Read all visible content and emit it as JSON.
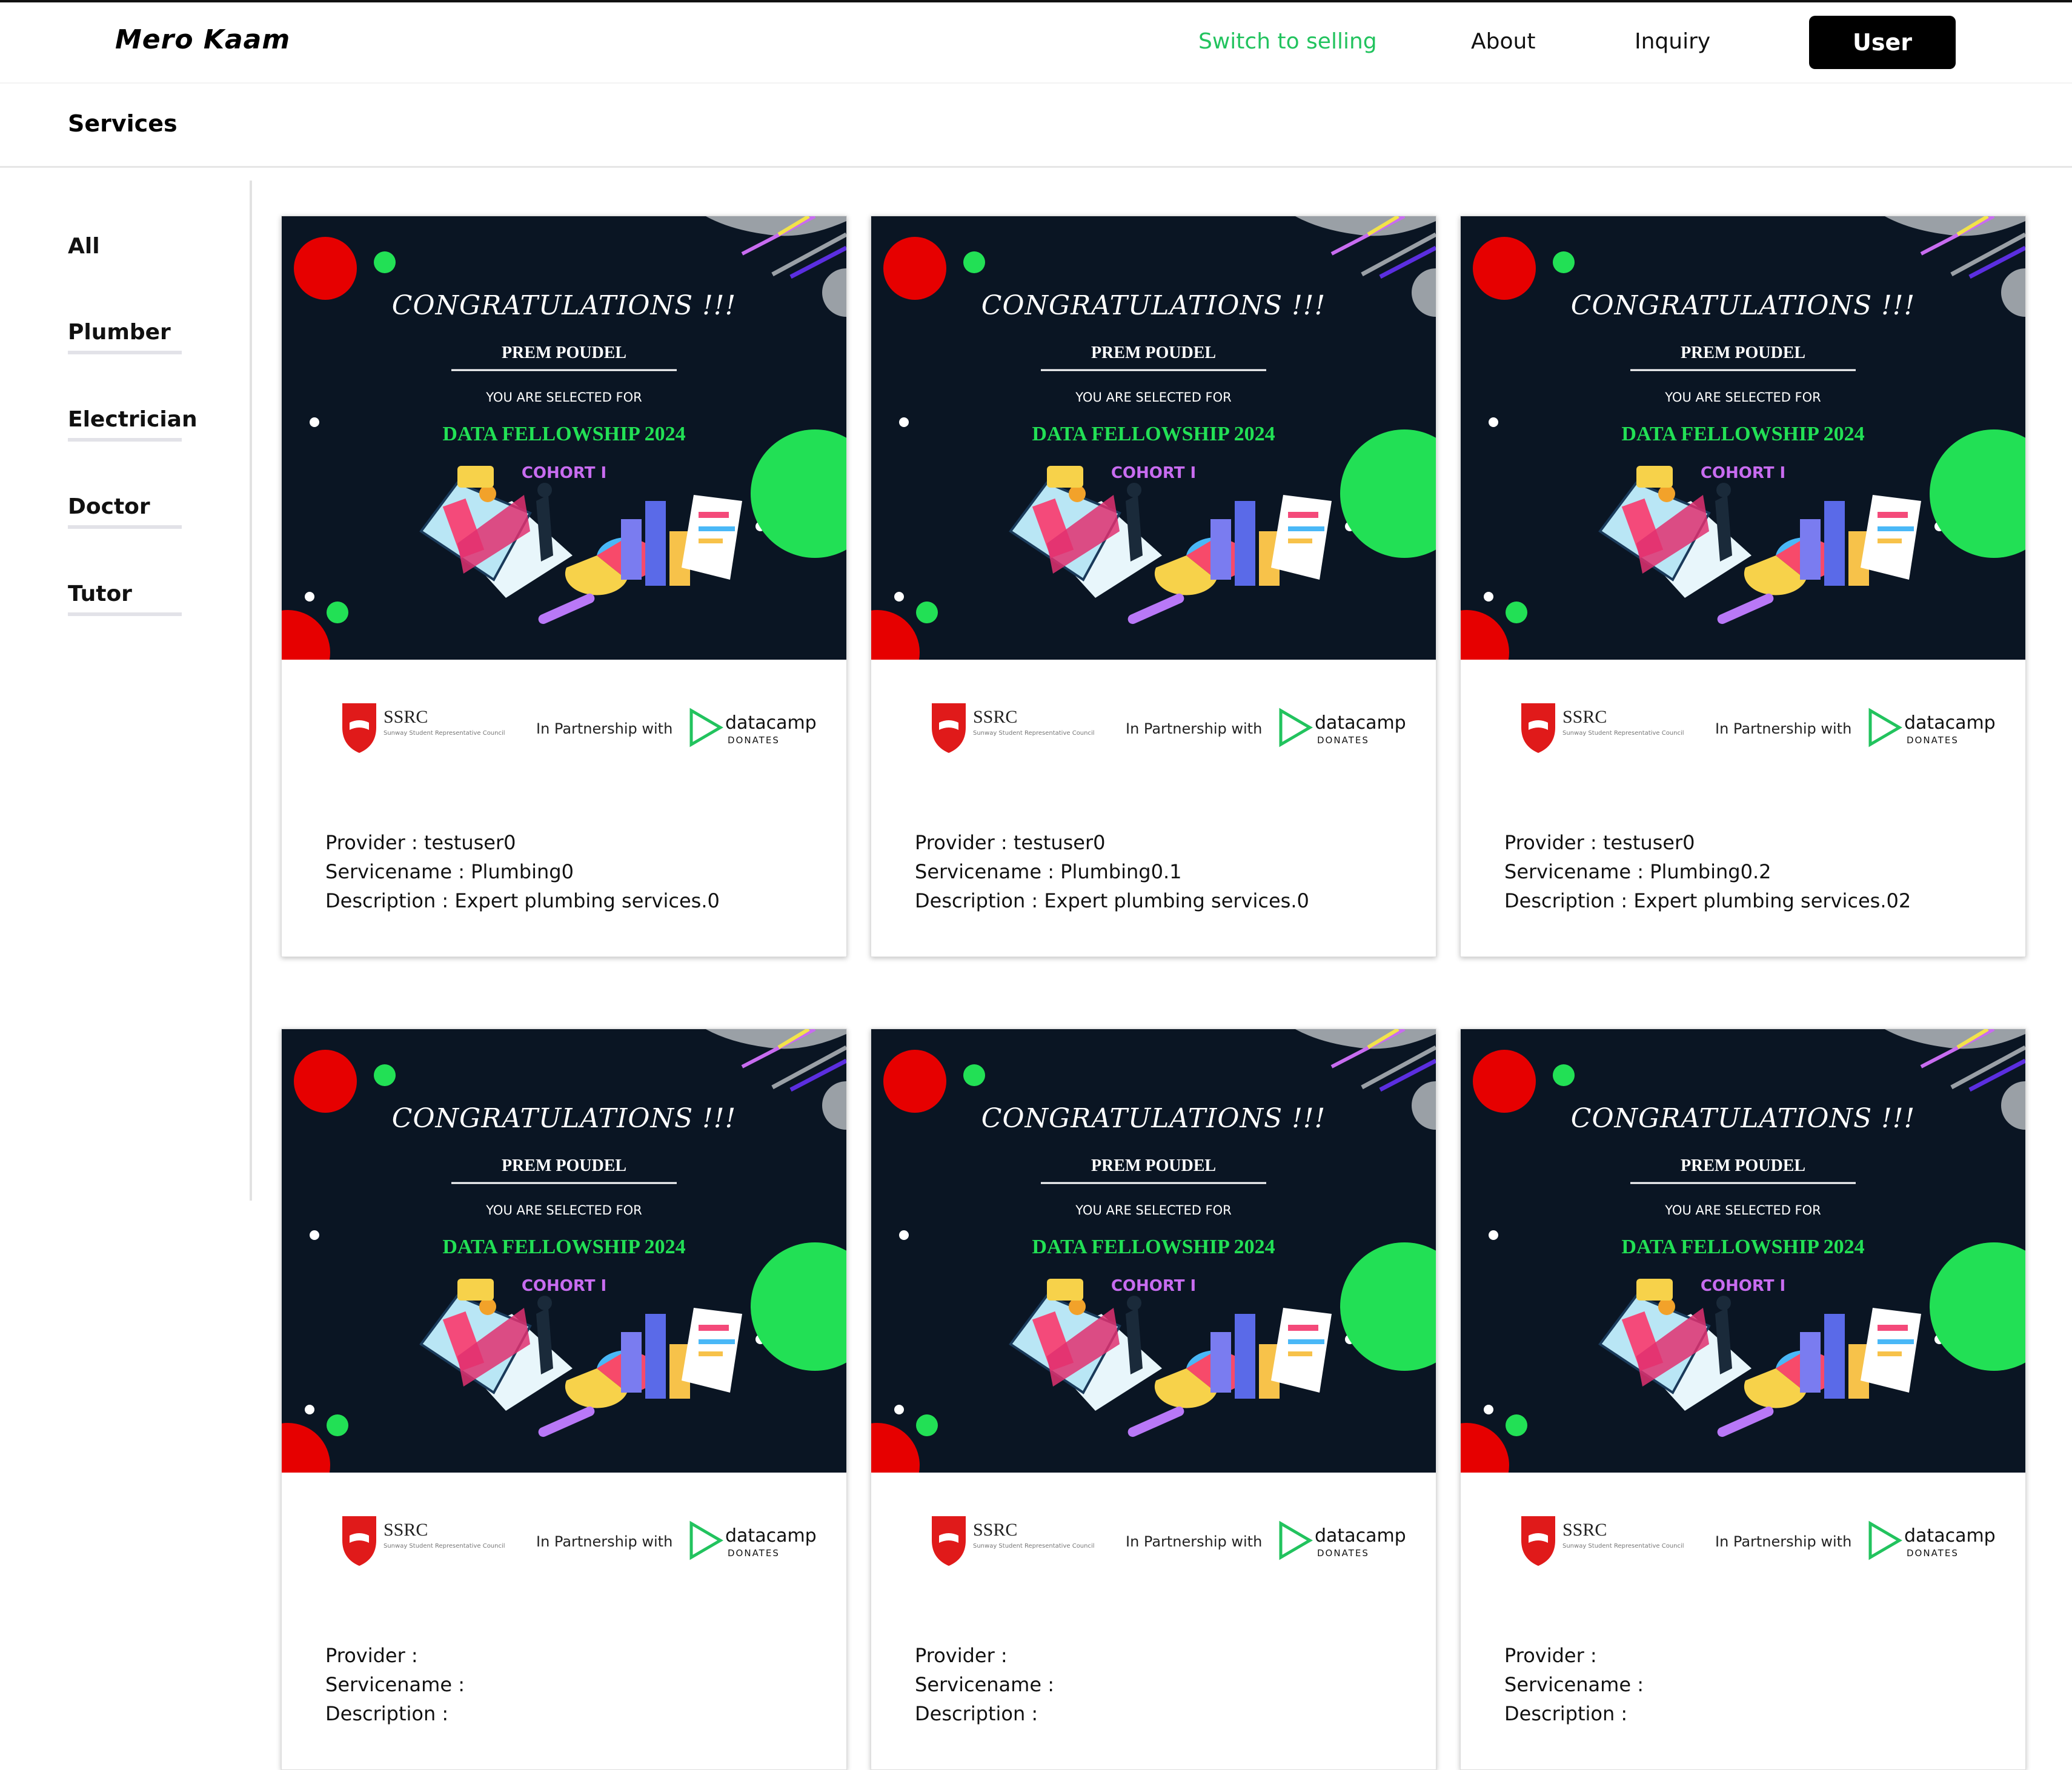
{
  "brand": "Mero Kaam",
  "nav": {
    "switch": "Switch to selling",
    "about": "About",
    "inquiry": "Inquiry",
    "user": "User"
  },
  "section_title": "Services",
  "categories": [
    "All",
    "Plumber",
    "Electrician",
    "Doctor",
    "Tutor"
  ],
  "certificate": {
    "heading": "CONGRATULATIONS !!!",
    "name": "PREM POUDEL",
    "selected": "YOU ARE SELECTED FOR",
    "program": "DATA FELLOWSHIP 2024",
    "cohort": "COHORT I",
    "org": "SSRC",
    "org_sub": "Sunway Student Representative Council",
    "partner_text": "In Partnership with",
    "partner_brand": "datacamp",
    "partner_sub": "DONATES"
  },
  "labels": {
    "provider": "Provider : ",
    "servicename": "Servicename : ",
    "description": "Description : "
  },
  "services": [
    {
      "provider": "testuser0",
      "servicename": "Plumbing0",
      "description": "Expert plumbing services.0"
    },
    {
      "provider": "testuser0",
      "servicename": "Plumbing0.1",
      "description": "Expert plumbing services.0"
    },
    {
      "provider": "testuser0",
      "servicename": "Plumbing0.2",
      "description": "Expert plumbing services.02"
    },
    {
      "provider": "",
      "servicename": "",
      "description": ""
    },
    {
      "provider": "",
      "servicename": "",
      "description": ""
    },
    {
      "provider": "",
      "servicename": "",
      "description": ""
    }
  ],
  "colors": {
    "accent_green": "#22c35e",
    "cert_bg": "#0a1523",
    "cert_green": "#22e055",
    "cert_purple": "#c86cf0",
    "red": "#e60000"
  }
}
